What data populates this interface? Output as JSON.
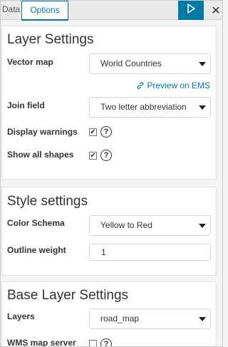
{
  "tabs": {
    "data_label": "Data",
    "options_label": "Options"
  },
  "toolbar": {
    "apply_icon": "play-icon",
    "close_label": "✕"
  },
  "layer_settings": {
    "title": "Layer Settings",
    "vector_map_label": "Vector map",
    "vector_map_value": "World Countries",
    "preview_link": "Preview on EMS",
    "join_field_label": "Join field",
    "join_field_value": "Two letter abbreviation",
    "display_warnings_label": "Display warnings",
    "display_warnings_checked": true,
    "show_all_shapes_label": "Show all shapes",
    "show_all_shapes_checked": true
  },
  "style_settings": {
    "title": "Style settings",
    "color_schema_label": "Color Schema",
    "color_schema_value": "Yellow to Red",
    "outline_weight_label": "Outline weight",
    "outline_weight_value": "1"
  },
  "base_layer_settings": {
    "title": "Base Layer Settings",
    "layers_label": "Layers",
    "layers_value": "road_map",
    "wms_label": "WMS map server",
    "wms_checked": false
  },
  "colors": {
    "accent": "#0079a5",
    "card_bg": "#ffffff",
    "page_bg": "#f4f4f4"
  }
}
